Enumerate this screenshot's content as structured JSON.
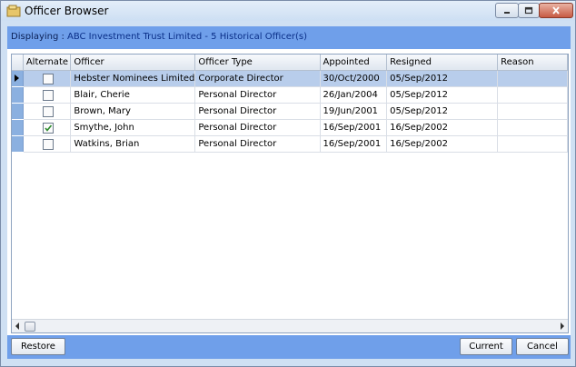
{
  "window": {
    "title": "Officer Browser"
  },
  "header": {
    "label": "Displaying :",
    "value": "ABC Investment Trust Limited - 5 Historical Officer(s)"
  },
  "grid": {
    "columns": [
      "Alternate",
      "Officer",
      "Officer Type",
      "Appointed",
      "Resigned",
      "Reason"
    ],
    "rows": [
      {
        "alternate": false,
        "officer": "Hebster Nominees Limited",
        "type": "Corporate Director",
        "appointed": "30/Oct/2000",
        "resigned": "05/Sep/2012",
        "reason": ""
      },
      {
        "alternate": false,
        "officer": "Blair, Cherie",
        "type": "Personal Director",
        "appointed": "26/Jan/2004",
        "resigned": "05/Sep/2012",
        "reason": ""
      },
      {
        "alternate": false,
        "officer": "Brown, Mary",
        "type": "Personal Director",
        "appointed": "19/Jun/2001",
        "resigned": "05/Sep/2012",
        "reason": ""
      },
      {
        "alternate": true,
        "officer": "Smythe, John",
        "type": "Personal Director",
        "appointed": "16/Sep/2001",
        "resigned": "16/Sep/2002",
        "reason": ""
      },
      {
        "alternate": false,
        "officer": "Watkins, Brian",
        "type": "Personal Director",
        "appointed": "16/Sep/2001",
        "resigned": "16/Sep/2002",
        "reason": ""
      }
    ]
  },
  "footer": {
    "restore_label": "Restore",
    "current_label": "Current",
    "cancel_label": "Cancel"
  },
  "colors": {
    "accent_bar": "#6f9fea",
    "selected_row": "#b8cdeb",
    "checkmark": "#2a8a2a"
  }
}
